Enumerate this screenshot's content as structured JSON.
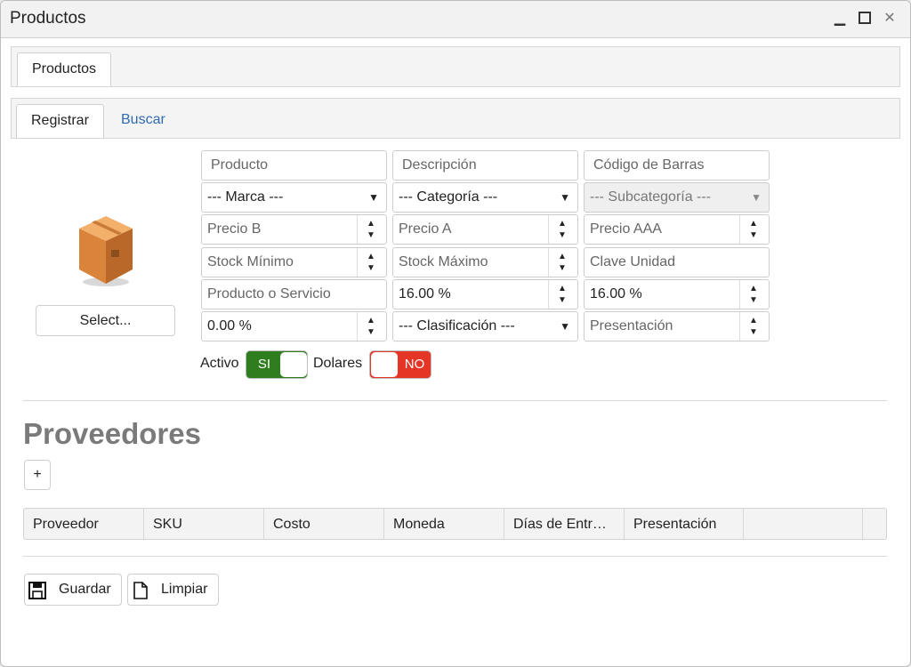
{
  "window": {
    "title": "Productos"
  },
  "outer_tabs": [
    {
      "label": "Productos"
    }
  ],
  "inner_tabs": {
    "register": "Registrar",
    "search": "Buscar"
  },
  "image_panel": {
    "select_label": "Select..."
  },
  "form": {
    "producto": {
      "placeholder": "Producto"
    },
    "descripcion": {
      "placeholder": "Descripción"
    },
    "codigo_barras": {
      "placeholder": "Código de Barras"
    },
    "marca": {
      "value": "--- Marca ---"
    },
    "categoria": {
      "value": "--- Categoría ---"
    },
    "subcategoria": {
      "value": "--- Subcategoría ---"
    },
    "precio_b": {
      "placeholder": "Precio B"
    },
    "precio_a": {
      "placeholder": "Precio A"
    },
    "precio_aaa": {
      "placeholder": "Precio AAA"
    },
    "stock_minimo": {
      "placeholder": "Stock Mínimo"
    },
    "stock_maximo": {
      "placeholder": "Stock Máximo"
    },
    "clave_unidad": {
      "placeholder": "Clave Unidad"
    },
    "producto_servicio": {
      "placeholder": "Producto o Servicio"
    },
    "iva": {
      "value": "16.00 %"
    },
    "impuesto2": {
      "value": "16.00 %"
    },
    "descuento": {
      "value": "0.00 %"
    },
    "clasificacion": {
      "value": "--- Clasificación ---"
    },
    "presentacion": {
      "placeholder": "Presentación"
    }
  },
  "toggles": {
    "activo": {
      "label": "Activo",
      "value": "SI",
      "color": "#2e7d1f"
    },
    "dolares": {
      "label": "Dolares",
      "value": "NO",
      "color": "#e53527"
    }
  },
  "proveedores": {
    "title": "Proveedores",
    "add_label": "+",
    "columns": [
      "Proveedor",
      "SKU",
      "Costo",
      "Moneda",
      "Días de Entr…",
      "Presentación"
    ]
  },
  "actions": {
    "save_label": "Guardar",
    "clear_label": "Limpiar"
  },
  "icons": [
    "minimize-icon",
    "maximize-icon",
    "close-icon",
    "box-icon",
    "dropdown-caret-icon",
    "spinner-icon",
    "save-icon",
    "document-icon"
  ]
}
